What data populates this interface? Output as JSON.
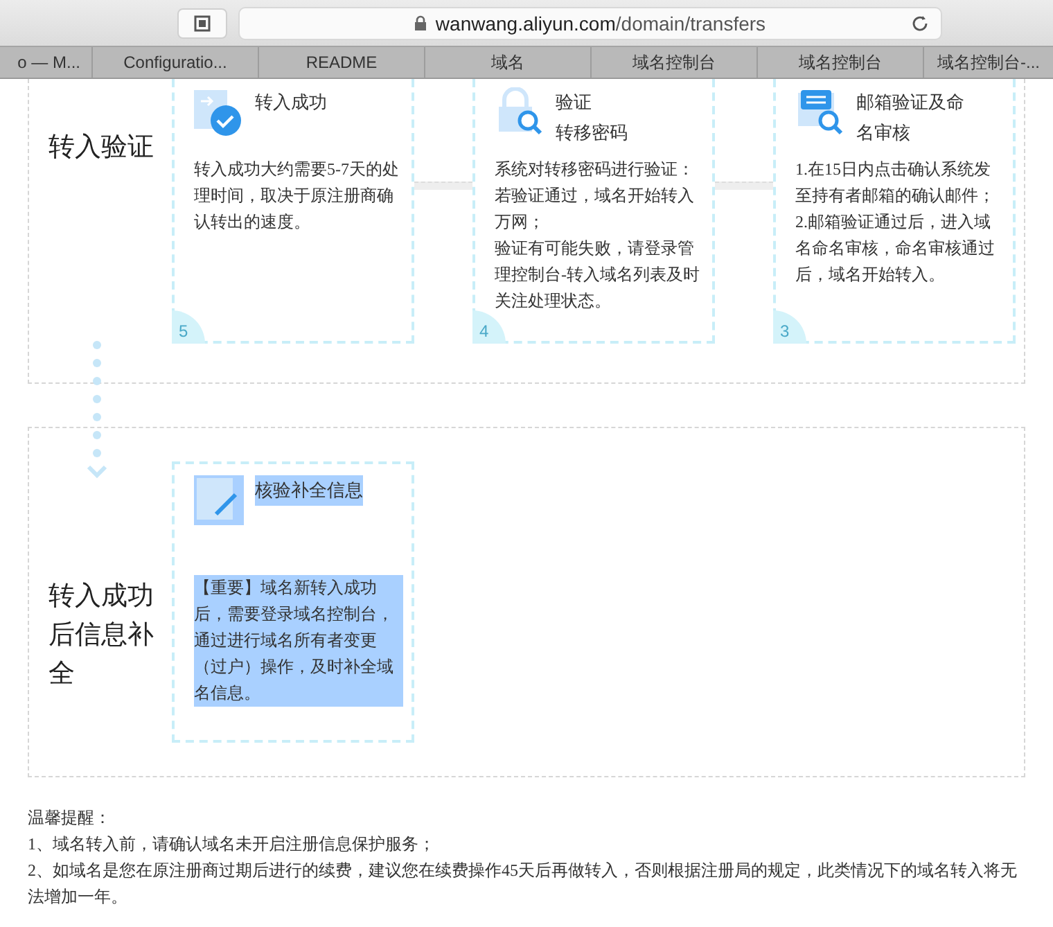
{
  "browser": {
    "url_host": "wanwang.aliyun.com",
    "url_path": "/domain/transfers"
  },
  "tabs": [
    {
      "label": "o — M..."
    },
    {
      "label": "Configuratio..."
    },
    {
      "label": "README"
    },
    {
      "label": "域名"
    },
    {
      "label": "域名控制台"
    },
    {
      "label": "域名控制台"
    },
    {
      "label": "域名控制台-..."
    }
  ],
  "sections": [
    {
      "label": "转入验证",
      "cards": [
        {
          "kind": "success",
          "title": [
            "转入成功"
          ],
          "body": [
            "转入成功大约需要5-7天的处理时间，取决于原注册商确认转出的速度。"
          ],
          "number": "5",
          "highlighted": false
        },
        {
          "kind": "lock",
          "title": [
            "验证",
            "转移密码"
          ],
          "body": [
            "系统对转移密码进行验证：",
            "若验证通过，域名开始转入万网；",
            "验证有可能失败，请登录管理控制台-转入域名列表及时关注处理状态。"
          ],
          "number": "4",
          "highlighted": false
        },
        {
          "kind": "mail",
          "title": [
            "邮箱验证及命名审核"
          ],
          "body": [
            "1.在15日内点击确认系统发至持有者邮箱的确认邮件；2.邮箱验证通过后，进入域名命名审核，命名审核通过后，域名开始转入。"
          ],
          "number": "3",
          "highlighted": false
        }
      ]
    },
    {
      "label": "转入成功后信息补全",
      "cards": [
        {
          "kind": "edit",
          "title": [
            "核验补全信息"
          ],
          "body": [
            "【重要】域名新转入成功后，需要登录域名控制台，通过进行域名所有者变更（过户）操作，及时补全域名信息。"
          ],
          "highlighted": true
        }
      ]
    }
  ],
  "notes": {
    "title": "温馨提醒：",
    "items": [
      "1、域名转入前，请确认域名未开启注册信息保护服务；",
      "2、如域名是您在原注册商过期后进行的续费，建议您在续费操作45天后再做转入，否则根据注册局的规定，此类情况下的域名转入将无法增加一年。"
    ]
  }
}
